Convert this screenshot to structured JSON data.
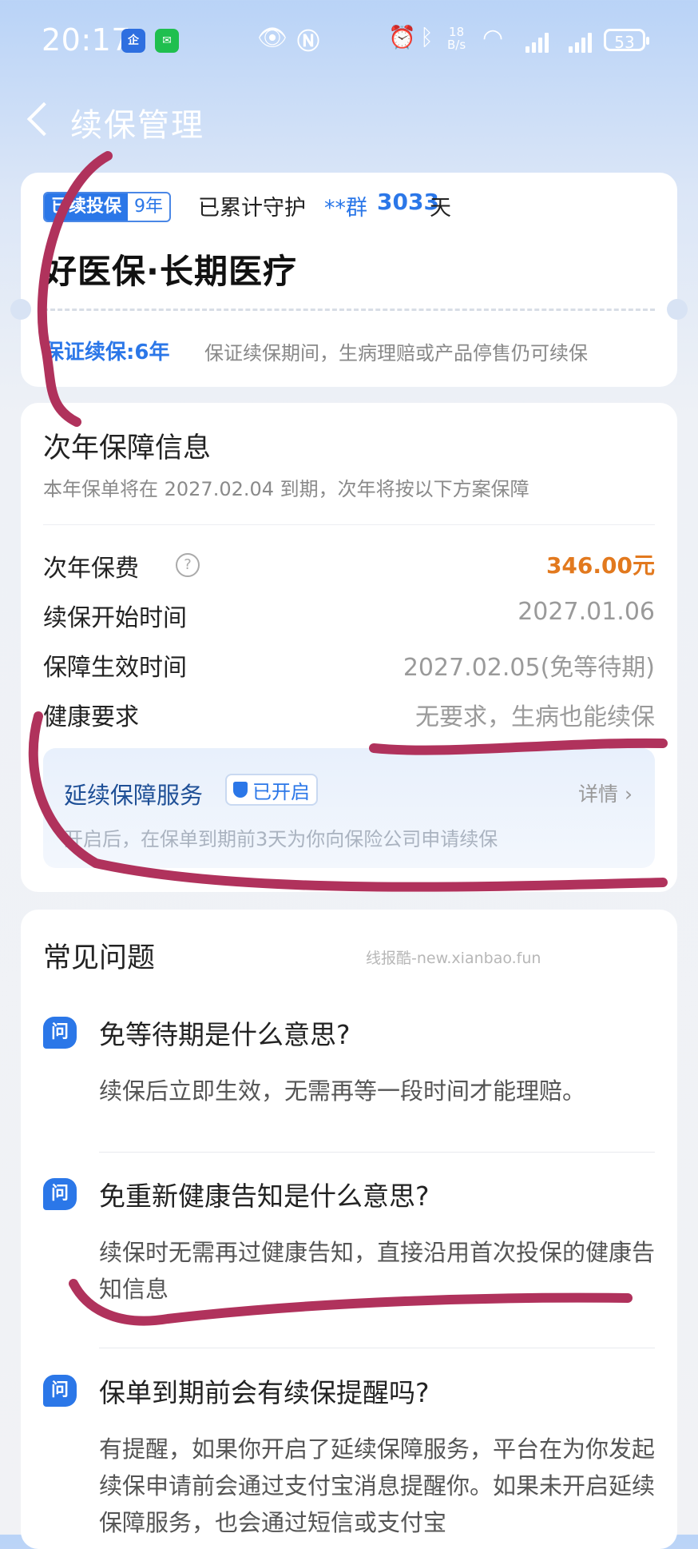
{
  "status_bar": {
    "time": "20:17",
    "app_badge_1": "企",
    "net_speed_top": "18",
    "net_speed_bottom": "B/s",
    "wifi_tag": "6",
    "battery": "53",
    "icons": [
      "eye-icon",
      "nfc-icon",
      "alarm-icon",
      "bluetooth-icon",
      "wifi-icon",
      "signal-icon",
      "battery-icon"
    ]
  },
  "header": {
    "title": "续保管理"
  },
  "policy": {
    "tag_main": "已续投保",
    "tag_years": "9年",
    "guard_text": "已累计守护",
    "guard_name": "**群",
    "guard_days": "3033",
    "guard_unit": "天",
    "product_name": "好医保·长期医疗",
    "guarantee_label": "保证续保:6年",
    "guarantee_desc": "保证续保期间，生病理赔或产品停售仍可续保"
  },
  "next_year": {
    "title": "次年保障信息",
    "subtitle": "本年保单将在 2027.02.04 到期，次年将按以下方案保障",
    "rows": [
      {
        "label": "次年保费",
        "value": "346.00元"
      },
      {
        "label": "续保开始时间",
        "value": "2027.01.06"
      },
      {
        "label": "保障生效时间",
        "value": "2027.02.05(免等待期)"
      },
      {
        "label": "健康要求",
        "value": "无要求，生病也能续保"
      }
    ],
    "service": {
      "title": "延续保障服务",
      "badge": "已开启",
      "detail": "详情",
      "desc": "开启后，在保单到期前3天为你向保险公司申请续保"
    }
  },
  "faq": {
    "title": "常见问题",
    "watermark": "线报酷-new.xianbao.fun",
    "icon_label": "问",
    "items": [
      {
        "q": "免等待期是什么意思?",
        "a": "续保后立即生效，无需再等一段时间才能理赔。"
      },
      {
        "q": "免重新健康告知是什么意思?",
        "a": "续保时无需再过健康告知，直接沿用首次投保的健康告知信息"
      },
      {
        "q": "保单到期前会有续保提醒吗?",
        "a": "有提醒，如果你开启了延续保障服务，平台在为你发起续保申请前会通过支付宝消息提醒你。如果未开启延续保障服务，也会通过短信或支付宝"
      }
    ]
  },
  "colors": {
    "accent": "#2b77e8",
    "price": "#e2791e",
    "ink": "#b0325c"
  }
}
